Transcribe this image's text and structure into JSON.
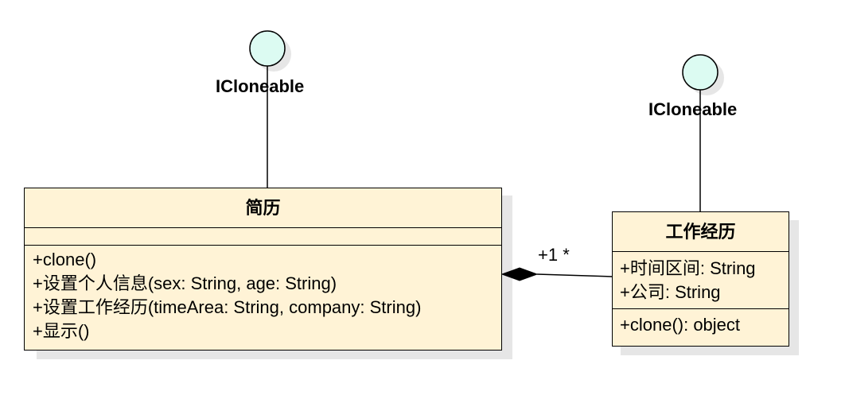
{
  "interfaces": [
    {
      "name": "ICloneable"
    },
    {
      "name": "ICloneable"
    }
  ],
  "resume_class": {
    "name": "简历",
    "attributes": [],
    "operations": [
      "+clone()",
      "+设置个人信息(sex: String, age: String)",
      "+设置工作经历(timeArea: String, company: String)",
      "+显示()"
    ]
  },
  "work_class": {
    "name": "工作经历",
    "attributes": [
      "+时间区间: String",
      "+公司: String"
    ],
    "operations": [
      "+clone(): object"
    ]
  },
  "association": {
    "multiplicity": "+1 *"
  },
  "colors": {
    "class_fill": "#fff3d6",
    "interface_fill": "#dcfbf2",
    "shadow": "#e6e6e6"
  }
}
